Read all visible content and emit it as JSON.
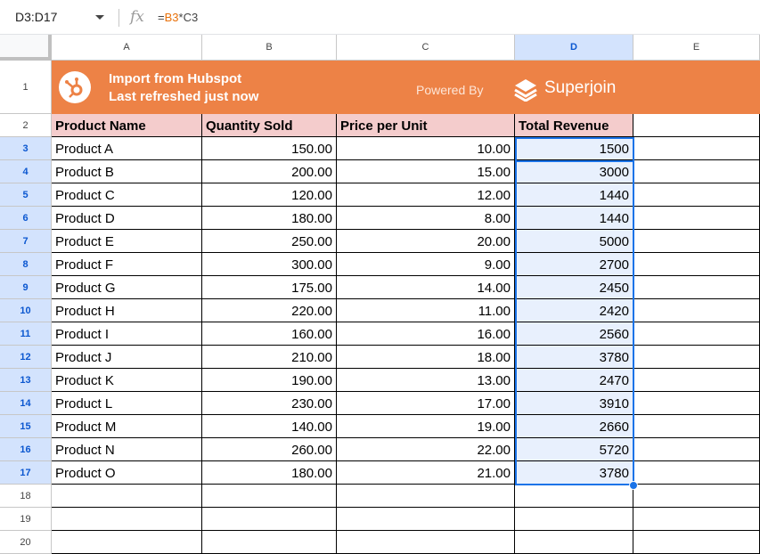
{
  "formula_bar": {
    "name_box": "D3:D17",
    "fx_label": "fx",
    "formula_prefix": "=",
    "formula_ref1": "B3",
    "formula_op": "*",
    "formula_ref2": "C3"
  },
  "columns": [
    "A",
    "B",
    "C",
    "D",
    "E"
  ],
  "selected_column": "D",
  "row_numbers": [
    "1",
    "2",
    "3",
    "4",
    "5",
    "6",
    "7",
    "8",
    "9",
    "10",
    "11",
    "12",
    "13",
    "14",
    "15",
    "16",
    "17",
    "18",
    "19",
    "20"
  ],
  "banner": {
    "title": "Import from Hubspot",
    "subtitle": "Last refreshed just now",
    "powered_by": "Powered By",
    "brand": "Superjoin",
    "color": "#ed8246"
  },
  "table": {
    "headers": [
      "Product Name",
      "Quantity Sold",
      "Price per Unit",
      "Total Revenue"
    ],
    "rows": [
      [
        "Product A",
        "150.00",
        "10.00",
        "1500"
      ],
      [
        "Product B",
        "200.00",
        "15.00",
        "3000"
      ],
      [
        "Product C",
        "120.00",
        "12.00",
        "1440"
      ],
      [
        "Product D",
        "180.00",
        "8.00",
        "1440"
      ],
      [
        "Product E",
        "250.00",
        "20.00",
        "5000"
      ],
      [
        "Product F",
        "300.00",
        "9.00",
        "2700"
      ],
      [
        "Product G",
        "175.00",
        "14.00",
        "2450"
      ],
      [
        "Product H",
        "220.00",
        "11.00",
        "2420"
      ],
      [
        "Product I",
        "160.00",
        "16.00",
        "2560"
      ],
      [
        "Product J",
        "210.00",
        "18.00",
        "3780"
      ],
      [
        "Product K",
        "190.00",
        "13.00",
        "2470"
      ],
      [
        "Product L",
        "230.00",
        "17.00",
        "3910"
      ],
      [
        "Product M",
        "140.00",
        "19.00",
        "2660"
      ],
      [
        "Product N",
        "260.00",
        "22.00",
        "5720"
      ],
      [
        "Product O",
        "180.00",
        "21.00",
        "3780"
      ]
    ]
  },
  "colors": {
    "header_fill": "#f4cccc",
    "selection": "#1a73e8",
    "selection_fill": "#e8f0fd"
  }
}
